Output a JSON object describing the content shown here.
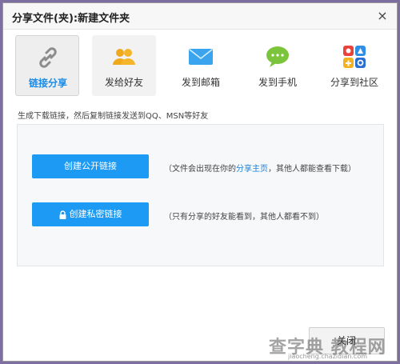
{
  "title": "分享文件(夹):新建文件夹",
  "close_icon_glyph": "×",
  "tabs": [
    {
      "label": "链接分享",
      "icon": "chain-link-icon",
      "active": true
    },
    {
      "label": "发给好友",
      "icon": "friends-icon",
      "active": false
    },
    {
      "label": "发到邮箱",
      "icon": "mail-icon",
      "active": false
    },
    {
      "label": "发到手机",
      "icon": "chat-bubble-icon",
      "active": false
    },
    {
      "label": "分享到社区",
      "icon": "community-icon",
      "active": false
    }
  ],
  "hint": "生成下载链接，然后复制链接发送到QQ、MSN等好友",
  "public_link": {
    "button": "创建公开链接",
    "desc_prefix": "（文件会出现在你的",
    "desc_link": "分享主页",
    "desc_suffix": "，其他人都能查看下载）"
  },
  "private_link": {
    "button": "创建私密链接",
    "desc": "（只有分享的好友能看到，其他人都看不到）"
  },
  "bottom_button": "关闭",
  "watermark": {
    "main": "查字典 教程网",
    "sub": "jiaocheng.chazidian.com"
  },
  "colors": {
    "accent": "#1d9af3",
    "link": "#1a7fd6",
    "active_tab_text": "#1a8be6"
  }
}
